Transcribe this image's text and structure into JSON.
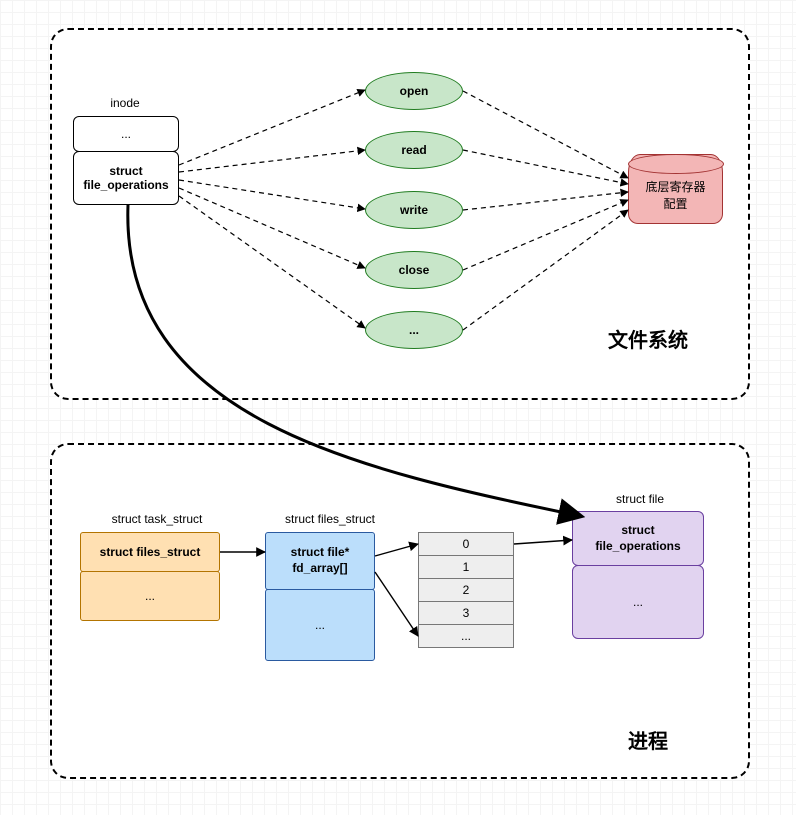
{
  "filesystem": {
    "title": "文件系统",
    "inode": {
      "title": "inode",
      "row1": "...",
      "row2": "struct file_operations"
    },
    "ops": [
      {
        "label": "open"
      },
      {
        "label": "read"
      },
      {
        "label": "write"
      },
      {
        "label": "close"
      },
      {
        "label": "..."
      }
    ],
    "register": {
      "line1": "底层寄存器",
      "line2": "配置"
    }
  },
  "process": {
    "title": "进程",
    "task_struct": {
      "title": "struct task_struct",
      "row1": "struct files_struct",
      "row2": "..."
    },
    "files_struct": {
      "title": "struct files_struct",
      "row1": "struct file* fd_array[]",
      "row2": "..."
    },
    "fd_array": [
      "0",
      "1",
      "2",
      "3",
      "..."
    ],
    "struct_file": {
      "title": "struct file",
      "row1": "struct file_operations",
      "row2": "..."
    }
  },
  "chart_data": {
    "type": "diagram",
    "title": "Linux file_operations link between file system and process",
    "nodes": [
      {
        "id": "inode",
        "label": "inode",
        "fields": [
          "...",
          "struct file_operations"
        ]
      },
      {
        "id": "op_open",
        "label": "open",
        "shape": "ellipse"
      },
      {
        "id": "op_read",
        "label": "read",
        "shape": "ellipse"
      },
      {
        "id": "op_write",
        "label": "write",
        "shape": "ellipse"
      },
      {
        "id": "op_close",
        "label": "close",
        "shape": "ellipse"
      },
      {
        "id": "op_more",
        "label": "...",
        "shape": "ellipse"
      },
      {
        "id": "hw_reg",
        "label": "底层寄存器配置",
        "shape": "cylinder"
      },
      {
        "id": "task_struct",
        "label": "struct task_struct",
        "fields": [
          "struct files_struct",
          "..."
        ]
      },
      {
        "id": "files_struct",
        "label": "struct files_struct",
        "fields": [
          "struct file* fd_array[]",
          "..."
        ]
      },
      {
        "id": "fd_array",
        "label": "fd_array",
        "cells": [
          "0",
          "1",
          "2",
          "3",
          "..."
        ]
      },
      {
        "id": "struct_file",
        "label": "struct file",
        "fields": [
          "struct file_operations",
          "..."
        ]
      }
    ],
    "edges": [
      {
        "from": "inode.file_operations",
        "to": "op_open",
        "style": "dashed"
      },
      {
        "from": "inode.file_operations",
        "to": "op_read",
        "style": "dashed"
      },
      {
        "from": "inode.file_operations",
        "to": "op_write",
        "style": "dashed"
      },
      {
        "from": "inode.file_operations",
        "to": "op_close",
        "style": "dashed"
      },
      {
        "from": "inode.file_operations",
        "to": "op_more",
        "style": "dashed"
      },
      {
        "from": "op_open",
        "to": "hw_reg",
        "style": "dashed"
      },
      {
        "from": "op_read",
        "to": "hw_reg",
        "style": "dashed"
      },
      {
        "from": "op_write",
        "to": "hw_reg",
        "style": "dashed"
      },
      {
        "from": "op_close",
        "to": "hw_reg",
        "style": "dashed"
      },
      {
        "from": "op_more",
        "to": "hw_reg",
        "style": "dashed"
      },
      {
        "from": "inode.file_operations",
        "to": "struct_file.file_operations",
        "style": "bold-curve"
      },
      {
        "from": "task_struct.files_struct",
        "to": "files_struct",
        "style": "solid"
      },
      {
        "from": "files_struct.fd_array",
        "to": "fd_array[0]",
        "style": "solid"
      },
      {
        "from": "files_struct.fd_array",
        "to": "fd_array[...]",
        "style": "solid"
      },
      {
        "from": "fd_array[0]",
        "to": "struct_file",
        "style": "solid"
      }
    ],
    "groups": [
      {
        "id": "filesystem",
        "label": "文件系统",
        "contains": [
          "inode",
          "op_open",
          "op_read",
          "op_write",
          "op_close",
          "op_more",
          "hw_reg"
        ]
      },
      {
        "id": "process",
        "label": "进程",
        "contains": [
          "task_struct",
          "files_struct",
          "fd_array",
          "struct_file"
        ]
      }
    ]
  }
}
